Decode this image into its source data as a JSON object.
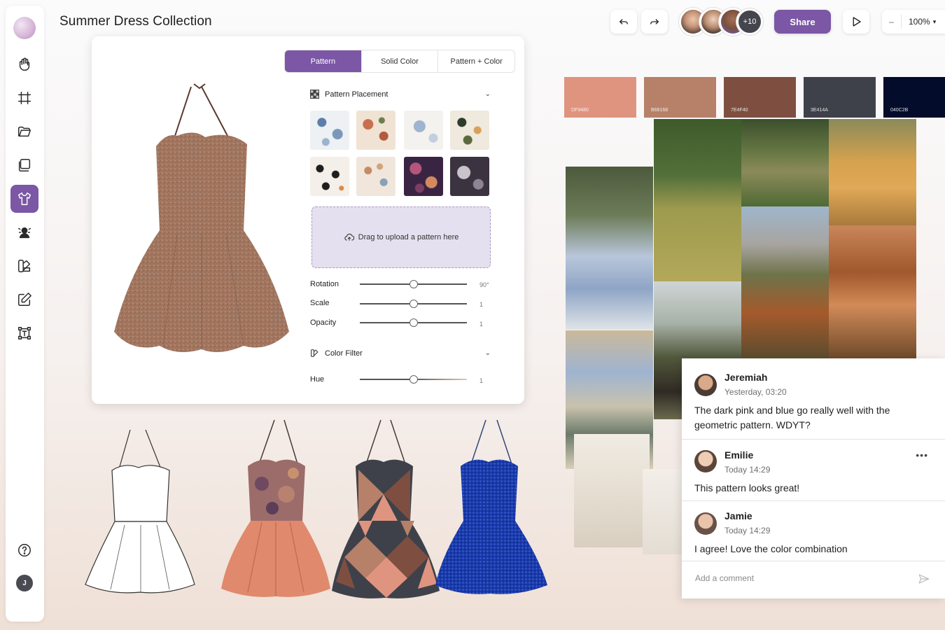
{
  "app": {
    "title": "Summer Dress Collection"
  },
  "toolbar": {
    "tools": [
      {
        "name": "hand-icon"
      },
      {
        "name": "frame-icon"
      },
      {
        "name": "folder-icon"
      },
      {
        "name": "layers-icon"
      },
      {
        "name": "garment-icon"
      },
      {
        "name": "avatar-scene-icon"
      },
      {
        "name": "palette-icon"
      },
      {
        "name": "edit-icon"
      },
      {
        "name": "text-frame-icon"
      }
    ],
    "help_icon": "help-icon",
    "user_initial": "J"
  },
  "topbar": {
    "undo_icon": "undo-icon",
    "redo_icon": "redo-icon",
    "collaborators_extra": "+10",
    "share_label": "Share",
    "play_icon": "play-icon",
    "zoom_minus": "–",
    "zoom_value": "100%"
  },
  "panel": {
    "tabs": [
      {
        "label": "Pattern",
        "active": true
      },
      {
        "label": "Solid Color",
        "active": false
      },
      {
        "label": "Pattern + Color",
        "active": false
      }
    ],
    "pattern_placement_label": "Pattern Placement",
    "upload_label": "Drag to upload a pattern here",
    "sliders": [
      {
        "label": "Rotation",
        "value": "90°",
        "position": 0.5
      },
      {
        "label": "Scale",
        "value": "1",
        "position": 0.5
      },
      {
        "label": "Opacity",
        "value": "1",
        "position": 0.5
      }
    ],
    "color_filter_label": "Color Filter",
    "hue": {
      "label": "Hue",
      "value": "1",
      "position": 0.5
    }
  },
  "palette": [
    {
      "hex": "#DF9480",
      "label": "DF9480"
    },
    {
      "hex": "#B68168",
      "label": "B68168"
    },
    {
      "hex": "#7E4F40",
      "label": "7E4F40"
    },
    {
      "hex": "#3E414A",
      "label": "3E414A"
    },
    {
      "hex": "#040C2B",
      "label": "040C2B"
    }
  ],
  "comments": [
    {
      "name": "Jeremiah",
      "time": "Yesterday, 03:20",
      "text": "The dark pink and blue go really well with the geometric pattern. WDYT?"
    },
    {
      "name": "Emilie",
      "time": "Today 14:29",
      "text": "This pattern looks great!"
    },
    {
      "name": "Jamie",
      "time": "Today 14:29",
      "text": "I agree! Love the color combination"
    }
  ],
  "comment_input": {
    "placeholder": "Add a comment"
  },
  "colors": {
    "accent": "#7b57a6"
  }
}
